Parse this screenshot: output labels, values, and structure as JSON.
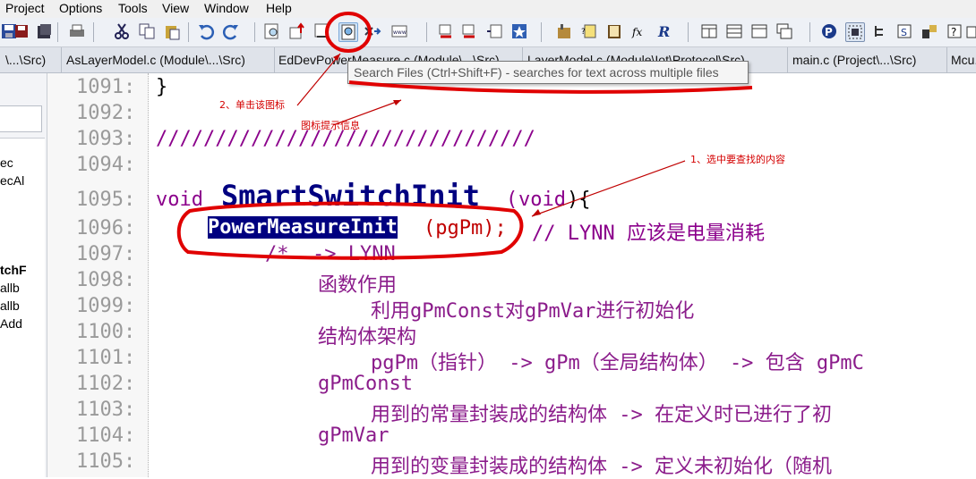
{
  "menubar": {
    "items": [
      "Project",
      "Options",
      "Tools",
      "View",
      "Window",
      "Help"
    ]
  },
  "toolbar": {
    "icons": [
      "save-icon",
      "save-all-icon",
      "close-file-icon",
      "print-icon",
      "cut-icon",
      "copy-icon",
      "paste-icon",
      "undo-icon",
      "redo-icon",
      "find-icon",
      "jump-icon",
      "replace-icon",
      "search-files-icon",
      "find-next-icon",
      "www-icon",
      "bookmark-prev-icon",
      "bookmark-next-icon",
      "list-icon",
      "star-icon",
      "lookup-icon",
      "reference-icon",
      "book-icon",
      "function-icon",
      "r-icon",
      "window-icon",
      "window2-icon",
      "window3-icon",
      "cascade-icon",
      "p-icon",
      "frame-icon",
      "tree-icon",
      "s-icon",
      "browse-icon",
      "relation-icon",
      "help-icon",
      "settings-icon"
    ]
  },
  "tabs": [
    "\\...\\Src)",
    "AsLayerModel.c (Module\\...\\Src)",
    "EdDevPowerMeasure.c (Module\\...\\Src)",
    "LayerModel.c (Module\\Iot\\Protocol\\Src)",
    "main.c (Project\\...\\Src)",
    "Mcu..."
  ],
  "tooltip": "Search Files (Ctrl+Shift+F) - searches for text across multiple files",
  "left_panel": {
    "items": [
      "ec",
      "ecAl",
      "tchF",
      "allb",
      "allb",
      "Add"
    ]
  },
  "editor": {
    "lines": [
      {
        "num": "1091:"
      },
      {
        "num": "1092:"
      },
      {
        "num": "1093:"
      },
      {
        "num": "1094:"
      },
      {
        "num": "1095:"
      },
      {
        "num": "1096:"
      },
      {
        "num": "1097:"
      },
      {
        "num": "1098:"
      },
      {
        "num": "1099:"
      },
      {
        "num": "1100:"
      },
      {
        "num": "1101:"
      },
      {
        "num": "1102:"
      },
      {
        "num": "1103:"
      },
      {
        "num": "1104:"
      },
      {
        "num": "1105:"
      }
    ],
    "brace": "}",
    "slashes": "////////////////////////////////",
    "void1": "void",
    "func_name": "SmartSwitchInit",
    "open_paren": "(",
    "void2": "void",
    "close_brace_open": "){",
    "selected_call": "PowerMeasureInit",
    "call_args": "(pgPm);",
    "comment1096": "// LYNN 应该是电量消耗",
    "comment1097": "/*  -> LYNN",
    "l1098": "函数作用",
    "l1099": "利用gPmConst对gPmVar进行初始化",
    "l1100": "结构体架构",
    "l1101": "pgPm（指针） -> gPm（全局结构体） -> 包含 gPmC",
    "l1102": "gPmConst",
    "l1103": "用到的常量封装成的结构体 -> 在定义时已进行了初",
    "l1104": "gPmVar",
    "l1105": "用到的变量封装成的结构体 -> 定义未初始化（随机"
  },
  "annotations": {
    "step2": "2、单击该图标",
    "tooltip_note": "图标提示信息",
    "step1": "1、选中要查找的内容"
  },
  "colors": {
    "annotation_red": "#e00000",
    "selection_bg": "#000080",
    "keyword": "#8b008b",
    "function": "#000080"
  }
}
